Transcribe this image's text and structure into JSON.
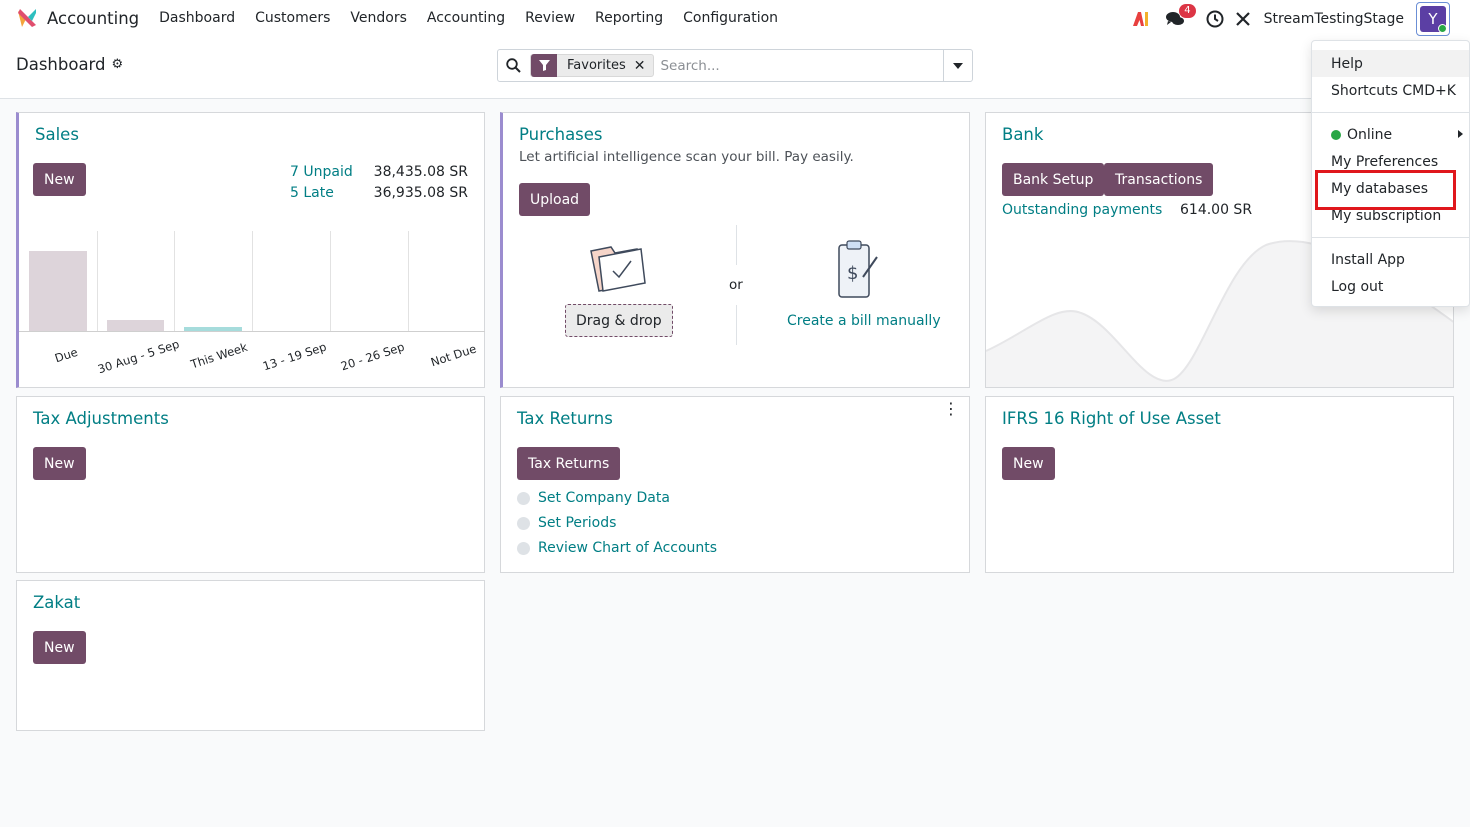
{
  "nav": {
    "app_name": "Accounting",
    "menu": [
      "Dashboard",
      "Customers",
      "Vendors",
      "Accounting",
      "Review",
      "Reporting",
      "Configuration"
    ],
    "message_count": "4",
    "company": "StreamTestingStage",
    "avatar_letter": "Y"
  },
  "control": {
    "title": "Dashboard",
    "facet_label": "Favorites",
    "search_placeholder": "Search..."
  },
  "sales": {
    "title": "Sales",
    "new_label": "New",
    "unpaid_label": "7 Unpaid",
    "unpaid_amount": "38,435.08 SR",
    "late_label": "5 Late",
    "late_amount": "36,935.08 SR",
    "chart_data": {
      "type": "bar",
      "categories": [
        "Due",
        "30 Aug - 5 Sep",
        "This Week",
        "13 - 19 Sep",
        "20 - 26 Sep",
        "Not Due"
      ],
      "values": [
        1.0,
        0.14,
        0.05,
        0,
        0,
        0
      ]
    }
  },
  "purchases": {
    "title": "Purchases",
    "subtitle": "Let artificial intelligence scan your bill. Pay easily.",
    "upload_label": "Upload",
    "drag_label": "Drag & drop",
    "or_label": "or",
    "manual_label": "Create a bill manually"
  },
  "bank": {
    "title": "Bank",
    "setup_label": "Bank Setup",
    "transactions_label": "Transactions",
    "outstanding_label": "Outstanding payments",
    "outstanding_amount": "614.00 SR"
  },
  "tax_adjustments": {
    "title": "Tax Adjustments",
    "new_label": "New"
  },
  "tax_returns": {
    "title": "Tax Returns",
    "button_label": "Tax Returns",
    "steps": [
      "Set Company Data",
      "Set Periods",
      "Review Chart of Accounts"
    ]
  },
  "ifrs": {
    "title": "IFRS 16 Right of Use Asset",
    "new_label": "New"
  },
  "zakat": {
    "title": "Zakat",
    "new_label": "New"
  },
  "user_menu": {
    "help": "Help",
    "shortcuts": "Shortcuts CMD+K",
    "online": "Online",
    "preferences": "My Preferences",
    "databases": "My databases",
    "subscription": "My subscription",
    "install_app": "Install App",
    "logout": "Log out"
  },
  "colors": {
    "primary": "#714b67",
    "link": "#017e84",
    "highlight": "#e0171c"
  }
}
